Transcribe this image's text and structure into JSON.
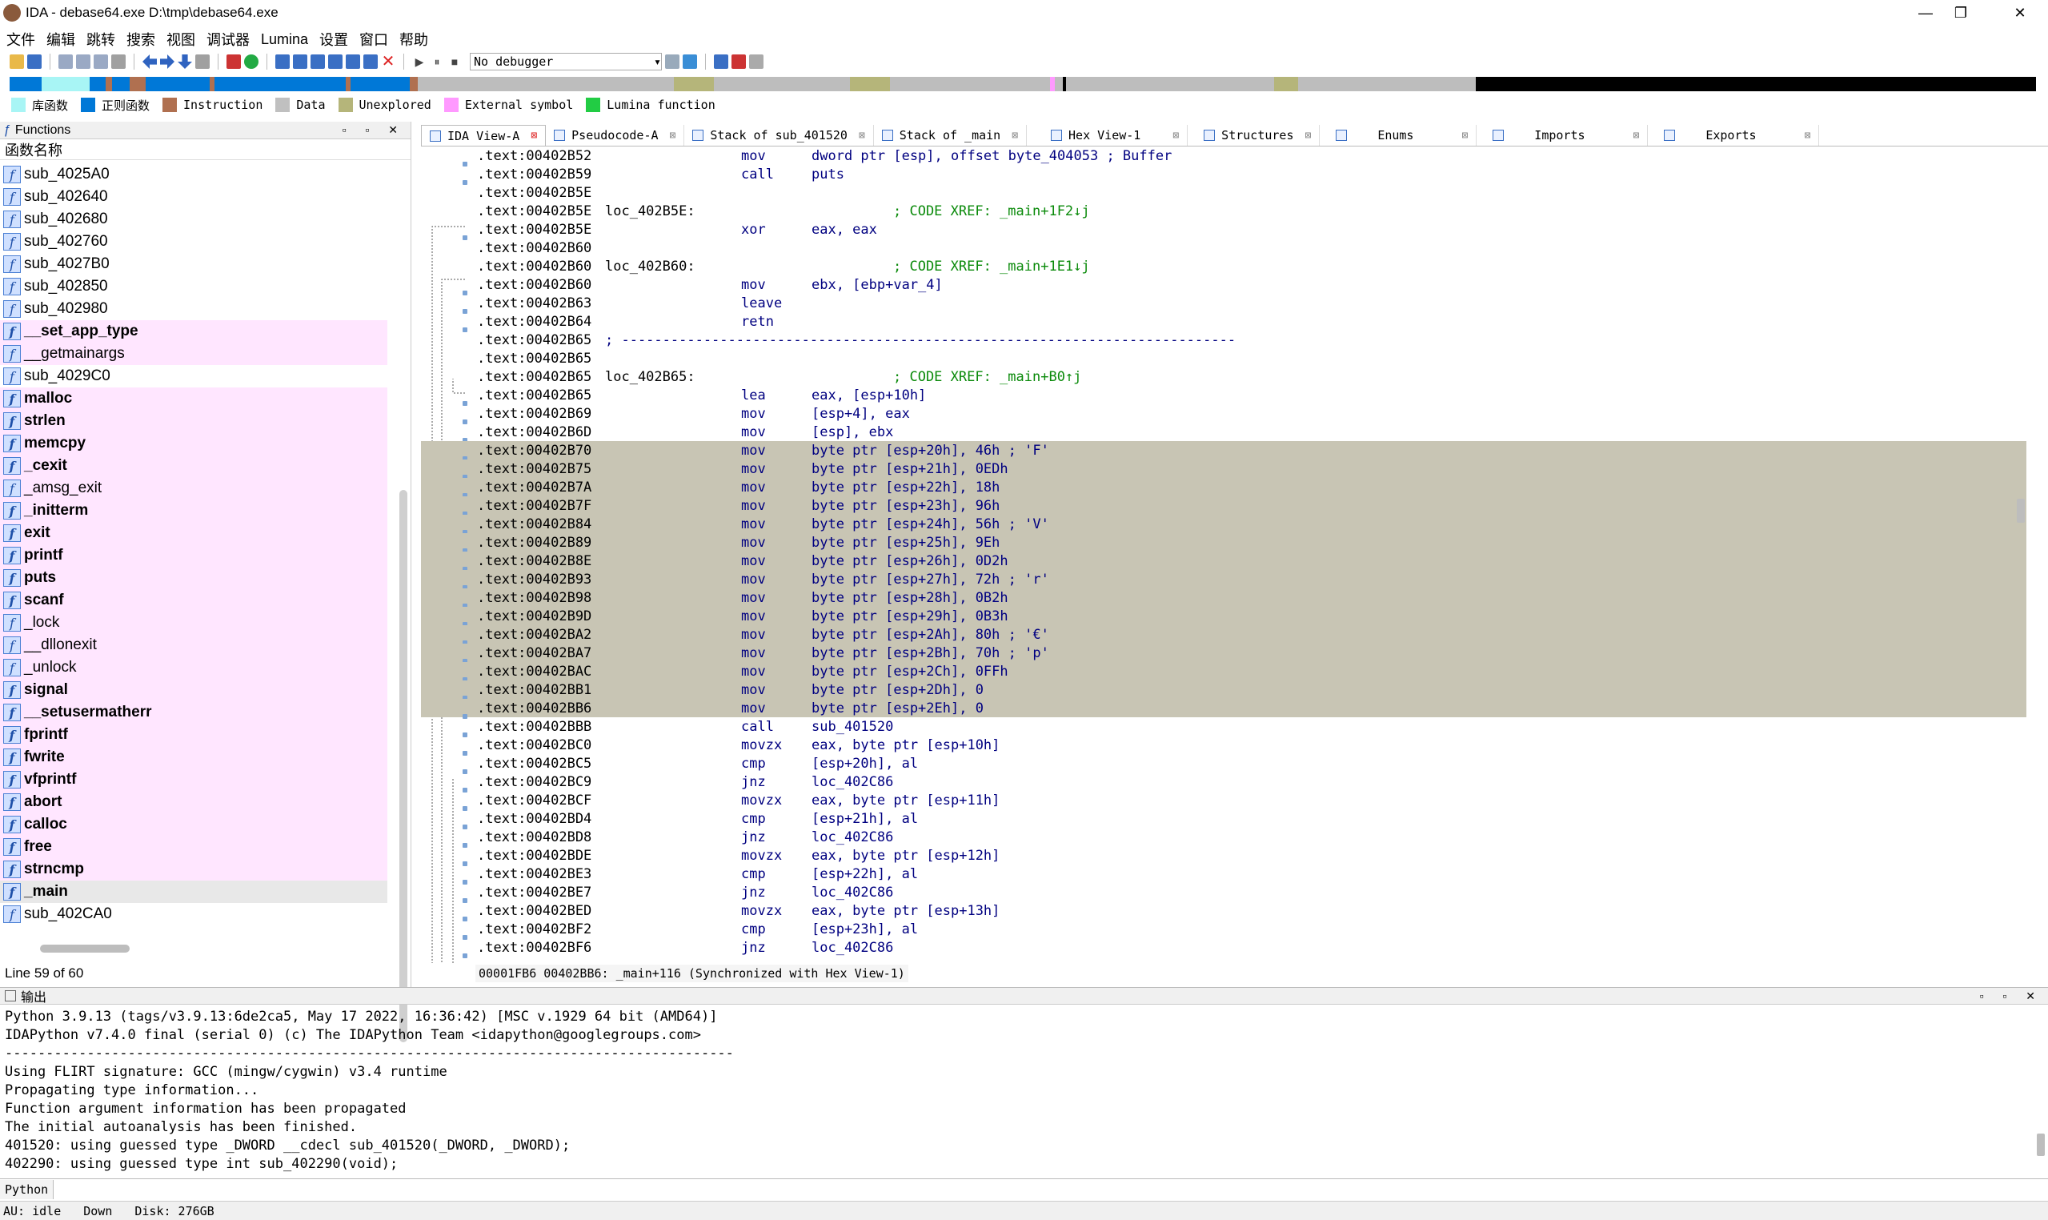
{
  "window": {
    "title": "IDA - debase64.exe D:\\tmp\\debase64.exe",
    "min": "—",
    "max": "❐",
    "close": "✕"
  },
  "menu": [
    "文件",
    "编辑",
    "跳转",
    "搜索",
    "视图",
    "调试器",
    "Lumina",
    "设置",
    "窗口",
    "帮助"
  ],
  "toolbar": {
    "debugger": "No debugger"
  },
  "legend": [
    {
      "label": "库函数",
      "color": "#a8f5f5"
    },
    {
      "label": "正则函数",
      "color": "#0078d7"
    },
    {
      "label": "Instruction",
      "color": "#b07050"
    },
    {
      "label": "Data",
      "color": "#c0c0c0"
    },
    {
      "label": "Unexplored",
      "color": "#b5b57a"
    },
    {
      "label": "External symbol",
      "color": "#ff99ff"
    },
    {
      "label": "Lumina function",
      "color": "#22cc44"
    }
  ],
  "functions_panel": {
    "title": "Functions",
    "column": "函数名称",
    "items": [
      {
        "name": "sub_4025A0",
        "kind": "normal"
      },
      {
        "name": "sub_402640",
        "kind": "normal"
      },
      {
        "name": "sub_402680",
        "kind": "normal"
      },
      {
        "name": "sub_402760",
        "kind": "normal"
      },
      {
        "name": "sub_4027B0",
        "kind": "normal"
      },
      {
        "name": "sub_402850",
        "kind": "normal"
      },
      {
        "name": "sub_402980",
        "kind": "normal"
      },
      {
        "name": "__set_app_type",
        "kind": "lib-bold"
      },
      {
        "name": "__getmainargs",
        "kind": "lib"
      },
      {
        "name": "sub_4029C0",
        "kind": "normal"
      },
      {
        "name": "malloc",
        "kind": "lib-bold"
      },
      {
        "name": "strlen",
        "kind": "lib-bold"
      },
      {
        "name": "memcpy",
        "kind": "lib-bold"
      },
      {
        "name": "_cexit",
        "kind": "lib-bold"
      },
      {
        "name": "_amsg_exit",
        "kind": "lib"
      },
      {
        "name": "_initterm",
        "kind": "lib-bold"
      },
      {
        "name": "exit",
        "kind": "lib-bold"
      },
      {
        "name": "printf",
        "kind": "lib-bold"
      },
      {
        "name": "puts",
        "kind": "lib-bold"
      },
      {
        "name": "scanf",
        "kind": "lib-bold"
      },
      {
        "name": "_lock",
        "kind": "lib"
      },
      {
        "name": "__dllonexit",
        "kind": "lib"
      },
      {
        "name": "_unlock",
        "kind": "lib"
      },
      {
        "name": "signal",
        "kind": "lib-bold"
      },
      {
        "name": "__setusermatherr",
        "kind": "lib-bold"
      },
      {
        "name": "fprintf",
        "kind": "lib-bold"
      },
      {
        "name": "fwrite",
        "kind": "lib-bold"
      },
      {
        "name": "vfprintf",
        "kind": "lib-bold"
      },
      {
        "name": "abort",
        "kind": "lib-bold"
      },
      {
        "name": "calloc",
        "kind": "lib-bold"
      },
      {
        "name": "free",
        "kind": "lib-bold"
      },
      {
        "name": "strncmp",
        "kind": "lib-bold"
      },
      {
        "name": "_main",
        "kind": "sel-bold"
      },
      {
        "name": "sub_402CA0",
        "kind": "normal"
      }
    ],
    "status": "Line 59 of 60"
  },
  "tabs": [
    {
      "label": "IDA View-A",
      "active": true
    },
    {
      "label": "Pseudocode-A"
    },
    {
      "label": "Stack of sub_401520"
    },
    {
      "label": "Stack of _main"
    },
    {
      "label": "Hex View-1"
    },
    {
      "label": "Structures"
    },
    {
      "label": "Enums"
    },
    {
      "label": "Imports"
    },
    {
      "label": "Exports"
    }
  ],
  "disasm": [
    {
      "addr": ".text:00402B52",
      "mn": "mov",
      "op": "dword ptr [esp], offset byte_404053 ; Buffer"
    },
    {
      "addr": ".text:00402B59",
      "mn": "call",
      "op": "puts"
    },
    {
      "addr": ".text:00402B5E"
    },
    {
      "addr": ".text:00402B5E",
      "lbl": "loc_402B5E:",
      "cm": "; CODE XREF: _main+1F2↓j"
    },
    {
      "addr": ".text:00402B5E",
      "mn": "xor",
      "op": "eax, eax"
    },
    {
      "addr": ".text:00402B60"
    },
    {
      "addr": ".text:00402B60",
      "lbl": "loc_402B60:",
      "cm": "; CODE XREF: _main+1E1↓j"
    },
    {
      "addr": ".text:00402B60",
      "mn": "mov",
      "op": "ebx, [ebp+var_4]"
    },
    {
      "addr": ".text:00402B63",
      "mn": "leave"
    },
    {
      "addr": ".text:00402B64",
      "mn": "retn"
    },
    {
      "addr": ".text:00402B65",
      "sep": "; ---------------------------------------------------------------------------"
    },
    {
      "addr": ".text:00402B65"
    },
    {
      "addr": ".text:00402B65",
      "lbl": "loc_402B65:",
      "cm": "; CODE XREF: _main+B0↑j"
    },
    {
      "addr": ".text:00402B65",
      "mn": "lea",
      "op": "eax, [esp+10h]"
    },
    {
      "addr": ".text:00402B69",
      "mn": "mov",
      "op": "[esp+4], eax"
    },
    {
      "addr": ".text:00402B6D",
      "mn": "mov",
      "op": "[esp], ebx"
    },
    {
      "addr": ".text:00402B70",
      "mn": "mov",
      "op": "byte ptr [esp+20h], 46h ; 'F'",
      "hl": true
    },
    {
      "addr": ".text:00402B75",
      "mn": "mov",
      "op": "byte ptr [esp+21h], 0EDh",
      "hl": true
    },
    {
      "addr": ".text:00402B7A",
      "mn": "mov",
      "op": "byte ptr [esp+22h], 18h",
      "hl": true
    },
    {
      "addr": ".text:00402B7F",
      "mn": "mov",
      "op": "byte ptr [esp+23h], 96h",
      "hl": true
    },
    {
      "addr": ".text:00402B84",
      "mn": "mov",
      "op": "byte ptr [esp+24h], 56h ; 'V'",
      "hl": true
    },
    {
      "addr": ".text:00402B89",
      "mn": "mov",
      "op": "byte ptr [esp+25h], 9Eh",
      "hl": true
    },
    {
      "addr": ".text:00402B8E",
      "mn": "mov",
      "op": "byte ptr [esp+26h], 0D2h",
      "hl": true
    },
    {
      "addr": ".text:00402B93",
      "mn": "mov",
      "op": "byte ptr [esp+27h], 72h ; 'r'",
      "hl": true
    },
    {
      "addr": ".text:00402B98",
      "mn": "mov",
      "op": "byte ptr [esp+28h], 0B2h",
      "hl": true
    },
    {
      "addr": ".text:00402B9D",
      "mn": "mov",
      "op": "byte ptr [esp+29h], 0B3h",
      "hl": true
    },
    {
      "addr": ".text:00402BA2",
      "mn": "mov",
      "op": "byte ptr [esp+2Ah], 80h ; '€'",
      "hl": true
    },
    {
      "addr": ".text:00402BA7",
      "mn": "mov",
      "op": "byte ptr [esp+2Bh], 70h ; 'p'",
      "hl": true
    },
    {
      "addr": ".text:00402BAC",
      "mn": "mov",
      "op": "byte ptr [esp+2Ch], 0FFh",
      "hl": true
    },
    {
      "addr": ".text:00402BB1",
      "mn": "mov",
      "op": "byte ptr [esp+2Dh], 0",
      "hl": true
    },
    {
      "addr": ".text:00402BB6",
      "mn": "mov",
      "op": "byte ptr [esp+2Eh], 0",
      "hl": true
    },
    {
      "addr": ".text:00402BBB",
      "mn": "call",
      "op": "sub_401520"
    },
    {
      "addr": ".text:00402BC0",
      "mn": "movzx",
      "op": "eax, byte ptr [esp+10h]"
    },
    {
      "addr": ".text:00402BC5",
      "mn": "cmp",
      "op": "[esp+20h], al"
    },
    {
      "addr": ".text:00402BC9",
      "mn": "jnz",
      "op": "loc_402C86"
    },
    {
      "addr": ".text:00402BCF",
      "mn": "movzx",
      "op": "eax, byte ptr [esp+11h]"
    },
    {
      "addr": ".text:00402BD4",
      "mn": "cmp",
      "op": "[esp+21h], al"
    },
    {
      "addr": ".text:00402BD8",
      "mn": "jnz",
      "op": "loc_402C86"
    },
    {
      "addr": ".text:00402BDE",
      "mn": "movzx",
      "op": "eax, byte ptr [esp+12h]"
    },
    {
      "addr": ".text:00402BE3",
      "mn": "cmp",
      "op": "[esp+22h], al"
    },
    {
      "addr": ".text:00402BE7",
      "mn": "jnz",
      "op": "loc_402C86"
    },
    {
      "addr": ".text:00402BED",
      "mn": "movzx",
      "op": "eax, byte ptr [esp+13h]"
    },
    {
      "addr": ".text:00402BF2",
      "mn": "cmp",
      "op": "[esp+23h], al"
    },
    {
      "addr": ".text:00402BF6",
      "mn": "jnz",
      "op": "loc_402C86"
    }
  ],
  "disasm_status": "00001FB6 00402BB6: _main+116 (Synchronized with Hex View-1)",
  "output": {
    "title": "输出",
    "lines": [
      "Python 3.9.13 (tags/v3.9.13:6de2ca5, May 17 2022, 16:36:42) [MSC v.1929 64 bit (AMD64)]",
      "IDAPython v7.4.0 final (serial 0) (c) The IDAPython Team <idapython@googlegroups.com>",
      "-----------------------------------------------------------------------------------------",
      "Using FLIRT signature: GCC (mingw/cygwin) v3.4 runtime",
      "Propagating type information...",
      "Function argument information has been propagated",
      "The initial autoanalysis has been finished.",
      "401520: using guessed type _DWORD __cdecl sub_401520(_DWORD, _DWORD);",
      "402290: using guessed type int sub_402290(void);"
    ]
  },
  "cmdline": {
    "lang": "Python"
  },
  "statusbar": {
    "au": "AU:  idle",
    "dir": "Down",
    "disk": "Disk: 276GB"
  }
}
